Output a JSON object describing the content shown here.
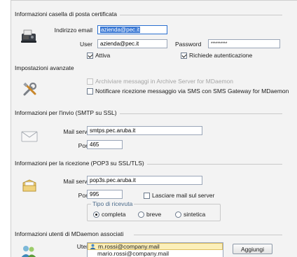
{
  "sections": {
    "pec": "Informazioni casella di posta certificata",
    "advanced": "Impostazioni avanzate",
    "smtp": "Informazioni per l'invio (SMTP su SSL)",
    "pop3": "Informazioni per la ricezione (POP3 su SSL/TLS)",
    "users": "Informazioni utenti di MDaemon associati"
  },
  "pec": {
    "email_label": "Indirizzo email",
    "email_value": "azienda@pec.it",
    "user_label": "User",
    "user_value": "azienda@pec.it",
    "password_label": "Password",
    "password_value": "**********",
    "active_label": "Attiva",
    "active_checked": true,
    "auth_label": "Richiede autenticazione",
    "auth_checked": true
  },
  "advanced": {
    "archive_label": "Archiviare messaggi in Archive Server for MDaemon",
    "archive_checked": false,
    "archive_disabled": true,
    "sms_label": "Notificare ricezione messaggio via SMS con SMS Gateway for MDaemon",
    "sms_checked": false
  },
  "smtp": {
    "server_label": "Mail server",
    "server_value": "smtps.pec.aruba.it",
    "port_label": "Porta",
    "port_value": "465"
  },
  "pop3": {
    "server_label": "Mail server",
    "server_value": "pop3s.pec.aruba.it",
    "port_label": "Porta",
    "port_value": "995",
    "leave_label": "Lasciare mail sul server",
    "leave_checked": false,
    "receipt_group": "Tipo di ricevuta",
    "receipt_options": [
      "completa",
      "breve",
      "sintetica"
    ],
    "receipt_selected": "completa"
  },
  "users": {
    "label": "Utenti",
    "items": [
      "m.rossi@company.mail",
      "mario.rossi@company.mail"
    ],
    "selected_index": 0,
    "add_button": "Aggiungi"
  },
  "icons": {
    "pec": "fax-machine-icon",
    "advanced": "tools-icon",
    "smtp": "envelope-icon",
    "pop3": "open-mailbox-icon",
    "users": "users-icon"
  }
}
